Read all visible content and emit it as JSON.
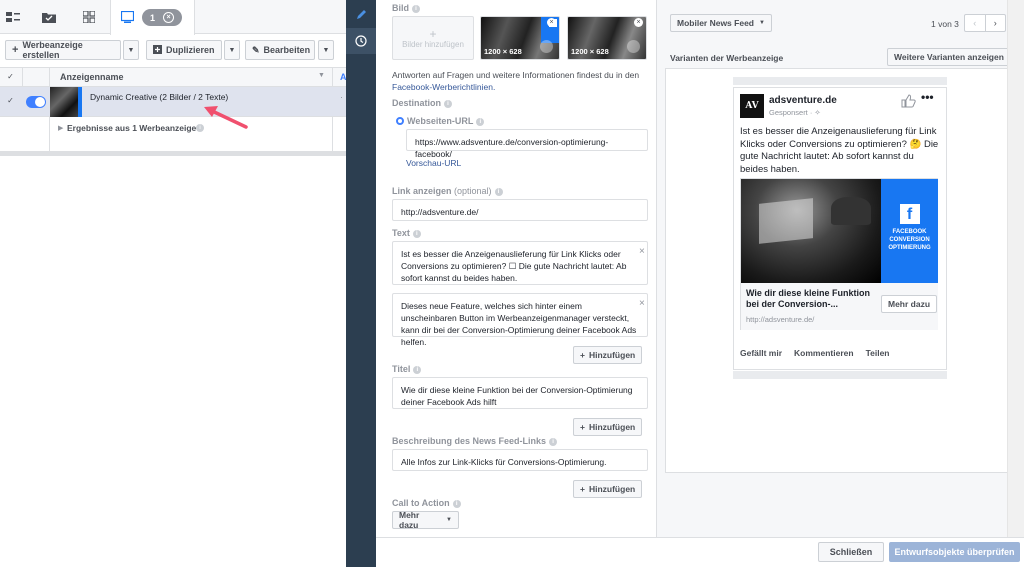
{
  "left": {
    "toolbar": {
      "create": "Werbeanzeige erstellen",
      "duplicate": "Duplizieren",
      "edit": "Bearbeiten"
    },
    "pill_count": "1",
    "pill_close": "×",
    "table": {
      "col_name": "Anzeigenname",
      "col_a": "A",
      "row_name": "Dynamic Creative (2 Bilder / 2 Texte)",
      "results": "Ergebnisse aus 1 Werbeanzeige"
    }
  },
  "editor": {
    "bild_label": "Bild",
    "add_image": "Bilder hinzufügen",
    "img1_size": "1200 × 628",
    "img2_size": "1200 × 628",
    "help_text": "Antworten auf Fragen und weitere Informationen findest du in den",
    "help_link": "Facebook-Werberichtlinien.",
    "destination_label": "Destination",
    "website_url_label": "Webseiten-URL",
    "website_url": "https://www.adsventure.de/conversion-optimierung-facebook/",
    "preview_url": "Vorschau-URL",
    "link_display_label": "Link anzeigen",
    "link_display_optional": "(optional)",
    "link_display": "http://adsventure.de/",
    "text_label": "Text",
    "text1": "Ist es besser die Anzeigenauslieferung für Link Klicks oder Conversions zu optimieren? ☐ Die gute Nachricht lautet: Ab sofort kannst du beides haben.",
    "text2": "Dieses neue Feature, welches sich hinter einem unscheinbaren Button im Werbeanzeigenmanager versteckt, kann dir bei der Conversion-Optimierung deiner Facebook Ads helfen.",
    "add": "Hinzufügen",
    "title_label": "Titel",
    "title_value": "Wie dir diese kleine Funktion bei der Conversion-Optimierung deiner Facebook Ads hilft",
    "desc_label": "Beschreibung des News Feed-Links",
    "desc_value": "Alle Infos zur Link-Klicks für Conversions-Optimierung.",
    "cta_label": "Call to Action",
    "cta_value": "Mehr dazu"
  },
  "preview": {
    "placement": "Mobiler News Feed",
    "pager": "1 von 3",
    "variants_label": "Varianten der Werbeanzeige",
    "more_variants": "Weitere Varianten anzeigen",
    "page_name": "adsventure.de",
    "sponsored": "Gesponsert · ✧",
    "logo": "AV",
    "body": "Ist es besser die Anzeigenauslieferung für Link Klicks oder Conversions zu optimieren? 🤔 Die gute Nachricht lautet: Ab sofort kannst du beides haben.",
    "fb_badge_line1": "FACEBOOK",
    "fb_badge_line2": "CONVERSION",
    "fb_badge_line3": "OPTIMIERUNG",
    "headline": "Wie dir diese kleine Funktion bei der Conversion-...",
    "cta": "Mehr dazu",
    "url": "http://adsventure.de/",
    "like": "Gefällt mir",
    "comment": "Kommentieren",
    "share": "Teilen"
  },
  "footer": {
    "close": "Schließen",
    "review": "Entwurfsobjekte überprüfen"
  },
  "colors": {
    "accent": "#4080ff",
    "sidebar": "#2c3e50",
    "fb_blue": "#1877f2"
  }
}
